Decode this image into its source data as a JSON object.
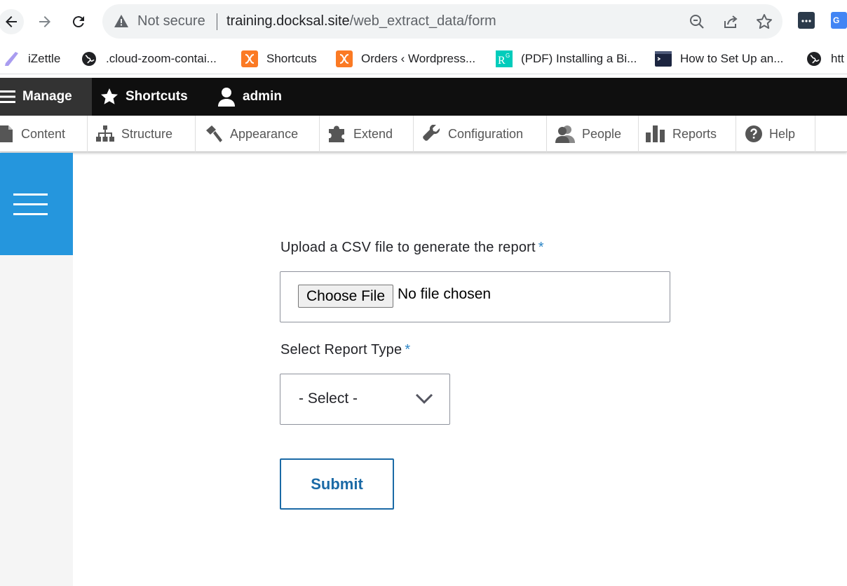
{
  "browser": {
    "not_secure_label": "Not secure",
    "url_host": "training.docksal.site",
    "url_path": "/web_extract_data/form",
    "icons": [
      "back-icon",
      "forward-icon",
      "reload-icon",
      "warning-icon",
      "zoom-icon",
      "share-icon",
      "star-icon",
      "extension-icon",
      "translate-icon"
    ]
  },
  "bookmarks": [
    {
      "label": "iZettle",
      "icon": "pen-icon"
    },
    {
      "label": ".cloud-zoom-contai...",
      "icon": "globe-icon"
    },
    {
      "label": "Shortcuts",
      "icon": "xampp-icon"
    },
    {
      "label": "Orders ‹ Wordpress...",
      "icon": "xampp-icon"
    },
    {
      "label": "(PDF) Installing a Bi...",
      "icon": "researchgate-icon"
    },
    {
      "label": "How to Set Up an...",
      "icon": "terminal-icon"
    },
    {
      "label": "htt",
      "icon": "globe-icon"
    }
  ],
  "toolbar": {
    "manage": "Manage",
    "shortcuts": "Shortcuts",
    "user": "admin"
  },
  "tray": [
    {
      "label": "Content",
      "icon": "file-icon"
    },
    {
      "label": "Structure",
      "icon": "sitemap-icon"
    },
    {
      "label": "Appearance",
      "icon": "paint-icon"
    },
    {
      "label": "Extend",
      "icon": "puzzle-icon"
    },
    {
      "label": "Configuration",
      "icon": "wrench-icon"
    },
    {
      "label": "People",
      "icon": "people-icon"
    },
    {
      "label": "Reports",
      "icon": "bar-chart-icon"
    },
    {
      "label": "Help",
      "icon": "help-icon"
    }
  ],
  "form": {
    "upload_label": "Upload a CSV file to generate the report",
    "required_marker": "*",
    "choose_file_label": "Choose File",
    "no_file_text": "No file chosen",
    "report_type_label": "Select Report Type",
    "report_type_value": "- Select -",
    "submit_label": "Submit"
  },
  "colors": {
    "accent_blue": "#2596dd",
    "toolbar_dark": "#0f0f0f",
    "submit_blue": "#1b6aa6"
  }
}
